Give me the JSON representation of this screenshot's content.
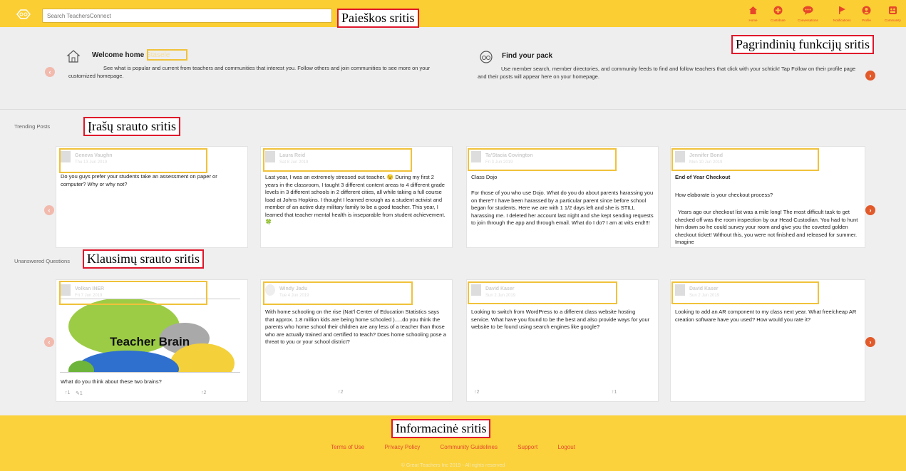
{
  "search": {
    "placeholder": "Search TeachersConnect"
  },
  "nav": [
    {
      "label": "Home",
      "icon": "home-icon"
    },
    {
      "label": "Contribute",
      "icon": "plus-icon"
    },
    {
      "label": "Conversations",
      "icon": "chat-icon"
    },
    {
      "label": "Notifications",
      "icon": "flag-icon"
    },
    {
      "label": "Profile",
      "icon": "user-icon"
    },
    {
      "label": "Community",
      "icon": "community-icon"
    }
  ],
  "callouts": {
    "search": "Paieškos sritis",
    "main_functions": "Pagrindinių funkcijų sritis",
    "posts": "Įrašų srauto sritis",
    "questions": "Klausimų srauto sritis",
    "info": "Informacinė sritis"
  },
  "hero": {
    "welcome_title": "Welcome home",
    "welcome_name": "Stasele",
    "welcome_text": "See what is popular and current from teachers and communities that interest you. Follow others and join communities to see more on your customized homepage.",
    "pack_title": "Find your pack",
    "pack_text": "Use member search, member directories, and community feeds to find and follow teachers that click with your schtick! Tap Follow on their profile page and their posts will appear here on your homepage."
  },
  "trending": {
    "label": "Trending Posts",
    "cards": [
      {
        "name": "Geneva Vaughn",
        "date": "Thu 13 Jun 2019",
        "body": "Do you guys prefer your students take an assessment on paper or computer? Why or why not?"
      },
      {
        "name": "Laura Reid",
        "date": "Sat 8 Jun 2019",
        "body": "Last year, I was an extremely stressed out teacher. 😉 During my first 2 years in the classroom, I taught 3 different content areas to 4 different grade levels in 3 different schools in 2 different cities, all while taking a full course load at Johns Hopkins. I thought I learned enough as a student activist and member of an active duty military family to be a good teacher. This year, I learned that teacher mental health is inseparable from student achievement. 🍀"
      },
      {
        "name": "Ta'Stacia Covington",
        "date": "Fri 3 Jun 2019",
        "title": "Class Dojo",
        "body": "For those of you who use Dojo.  What do you do about parents harassing you on there?  I have been harassed by a particular parent since before school began for students.  Here we are with 1 1/2 days left and she is STILL harassing me.  I deleted her account last night and she kept sending requests to join through the app and through email.  What do I do?  I am at wits end!!!!"
      },
      {
        "name": "Jennifer Bond",
        "date": "Mon 10 Jun 2019",
        "title": "End of Year Checkout",
        "subtitle": "How elaborate is your checkout process?",
        "body": "  Years ago our checkout list was a mile long! The most difficult task to get checked off was the room inspection by our Head Custodian. You had to hunt him down so he could survey your room and give you the coveted golden checkout ticket! Without this, you were not finished and released for summer. Imagine"
      }
    ]
  },
  "questions": {
    "label": "Unanswered Questions",
    "cards": [
      {
        "name": "Volkan INER",
        "date": "Fri 7 Jun 2019",
        "image_text": "Teacher Brain",
        "body": "What do you think about these two brains?",
        "votes_left": "1",
        "votes_mid": "1",
        "votes_right": "2"
      },
      {
        "name": "Windy Jadu",
        "date": "Tue 4 Jun 2019",
        "body": "With home schooling on the rise (Nat'l Center of Education Statistics says that approx. 1.8 million kids are being home schooled ).....do you think the parents who home school their children are any less of a teacher than those who are actually trained and certified to teach? Does home schooling pose a threat to you or your school district?",
        "votes_left": "2"
      },
      {
        "name": "David Kaser",
        "date": "Sun 2 Jun 2019",
        "body": "Looking to switch from WordPress to a different class website hosting service. What have you found to be the best and also provide ways for your website to be found using search engines like google?",
        "votes_left": "2",
        "votes_right": "1"
      },
      {
        "name": "David Kaser",
        "date": "Sun 2 Jun 2019",
        "body": "Looking to add an AR component to my class next year. What free/cheap AR creation software have you used?  How would you rate it?"
      }
    ]
  },
  "footer": {
    "links": [
      "Terms of Use",
      "Privacy Policy",
      "Community Guidelines",
      "Support",
      "Logout"
    ],
    "copyright": "© Great Teachers Inc 2019 - All rights reserved"
  },
  "colors": {
    "brand_yellow": "#fbce34",
    "accent_orange": "#e25a2a",
    "highlight": "#f0c23a",
    "callout_red": "#e0162b"
  }
}
